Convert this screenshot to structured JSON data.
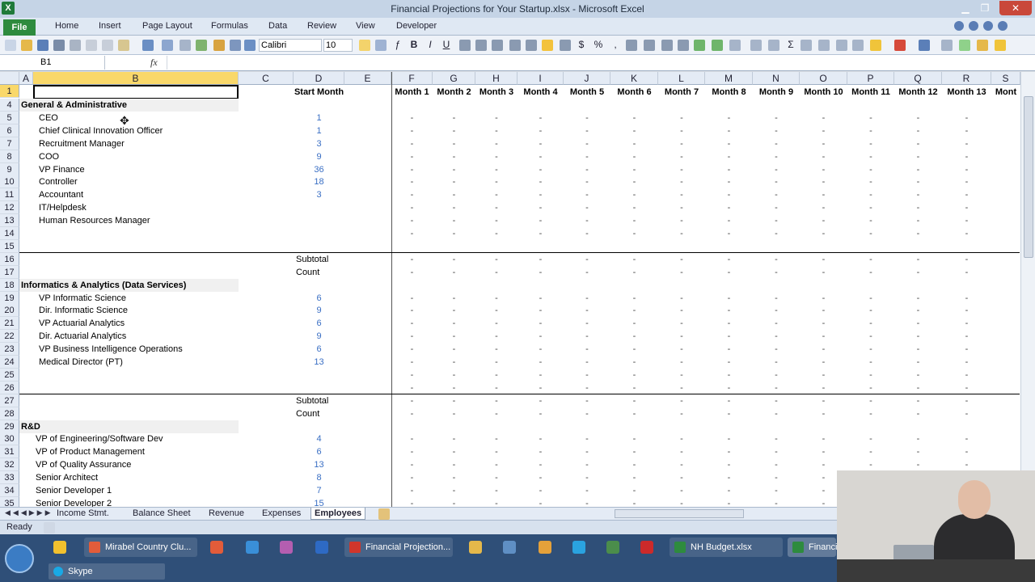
{
  "window": {
    "title": "Financial Projections for Your Startup.xlsx - Microsoft Excel",
    "app_icon": "X",
    "min_glyph": "▁",
    "max_glyph": "❐",
    "close_glyph": "✕"
  },
  "ribbon_tabs": [
    "File",
    "Home",
    "Insert",
    "Page Layout",
    "Formulas",
    "Data",
    "Review",
    "View",
    "Developer"
  ],
  "toolbar": {
    "font_name": "Calibri",
    "font_size": "10",
    "bold": "B",
    "italic": "I",
    "underline": "U",
    "currency": "$",
    "percent": "%",
    "comma": ",",
    "autosum": "Σ"
  },
  "formula_bar": {
    "cell_ref": "B1",
    "fx": "fx",
    "value": ""
  },
  "columns": [
    "A",
    "B",
    "C",
    "D",
    "E",
    "F",
    "G",
    "H",
    "I",
    "J",
    "K",
    "L",
    "M",
    "N",
    "O",
    "P",
    "Q",
    "R",
    "S"
  ],
  "header_row": {
    "row_num": "1",
    "start_month": "Start Month",
    "months": [
      "Month 1",
      "Month 2",
      "Month 3",
      "Month 4",
      "Month 5",
      "Month 6",
      "Month 7",
      "Month 8",
      "Month 9",
      "Month 10",
      "Month 11",
      "Month 12",
      "Month 13",
      "Mont"
    ]
  },
  "rows": [
    {
      "num": "4",
      "type": "section",
      "label": "General & Administrative",
      "start": ""
    },
    {
      "num": "5",
      "type": "item",
      "label": "CEO",
      "start": "1"
    },
    {
      "num": "6",
      "type": "item",
      "label": "Chief Clinical Innovation Officer",
      "start": "1"
    },
    {
      "num": "7",
      "type": "item",
      "label": "Recruitment Manager",
      "start": "3"
    },
    {
      "num": "8",
      "type": "item",
      "label": "COO",
      "start": "9"
    },
    {
      "num": "9",
      "type": "item",
      "label": "VP Finance",
      "start": "36"
    },
    {
      "num": "10",
      "type": "item",
      "label": "Controller",
      "start": "18"
    },
    {
      "num": "11",
      "type": "item",
      "label": "Accountant",
      "start": "3"
    },
    {
      "num": "12",
      "type": "item",
      "label": "IT/Helpdesk",
      "start": ""
    },
    {
      "num": "13",
      "type": "item",
      "label": "Human Resources Manager",
      "start": ""
    },
    {
      "num": "14",
      "type": "blank",
      "label": "",
      "start": ""
    },
    {
      "num": "15",
      "type": "blank",
      "label": "",
      "start": ""
    },
    {
      "num": "16",
      "type": "summary",
      "label": "Subtotal",
      "start": ""
    },
    {
      "num": "17",
      "type": "summary",
      "label": "Count",
      "start": ""
    },
    {
      "num": "18",
      "type": "section",
      "label": "Informatics & Analytics (Data Services)",
      "start": ""
    },
    {
      "num": "19",
      "type": "item",
      "label": "VP Informatic Science",
      "start": "6"
    },
    {
      "num": "20",
      "type": "item",
      "label": "Dir. Informatic Science",
      "start": "9"
    },
    {
      "num": "21",
      "type": "item",
      "label": "VP Actuarial Analytics",
      "start": "6"
    },
    {
      "num": "22",
      "type": "item",
      "label": "Dir. Actuarial Analytics",
      "start": "9"
    },
    {
      "num": "23",
      "type": "item",
      "label": "VP Business Intelligence Operations",
      "start": "6"
    },
    {
      "num": "24",
      "type": "item",
      "label": "Medical Director (PT)",
      "start": "13"
    },
    {
      "num": "25",
      "type": "blank",
      "label": "",
      "start": ""
    },
    {
      "num": "26",
      "type": "blank",
      "label": "",
      "start": ""
    },
    {
      "num": "27",
      "type": "summary",
      "label": "Subtotal",
      "start": ""
    },
    {
      "num": "28",
      "type": "summary",
      "label": "Count",
      "start": ""
    },
    {
      "num": "29",
      "type": "section",
      "label": "R&D",
      "start": ""
    },
    {
      "num": "30",
      "type": "item2",
      "label": "VP of Engineering/Software Dev",
      "start": "4"
    },
    {
      "num": "31",
      "type": "item2",
      "label": "VP of Product Management",
      "start": "6"
    },
    {
      "num": "32",
      "type": "item2",
      "label": "VP of Quality Assurance",
      "start": "13"
    },
    {
      "num": "33",
      "type": "item2",
      "label": "Senior Architect",
      "start": "8"
    },
    {
      "num": "34",
      "type": "item2",
      "label": "Senior Developer 1",
      "start": "7"
    },
    {
      "num": "35",
      "type": "item2",
      "label": "Senior Developer 2",
      "start": "15"
    }
  ],
  "dash": "-",
  "sheet_tabs": [
    "Income Stmt.",
    "Balance Sheet",
    "Revenue",
    "Expenses",
    "Employees"
  ],
  "active_sheet": "Employees",
  "tab_nav": "◀◀◀▶▶▶",
  "status": "Ready",
  "taskbar": {
    "items": [
      "Mirabel Country Clu...",
      "Financial Projection...",
      "NH Budget.xlsx",
      "Financi"
    ],
    "skype": "Skype"
  },
  "colors": {
    "excel_green": "#2e8b3e",
    "selection_yellow": "#f9d86a",
    "start_month_blue": "#3a6fc4",
    "taskbar_blue": "#2f4f78"
  }
}
